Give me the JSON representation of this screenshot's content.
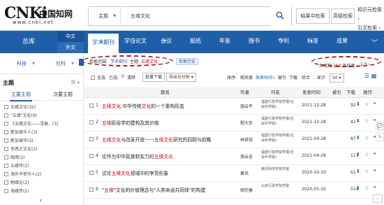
{
  "header": {
    "logo_text": "CNKi",
    "logo_cn": "中国知网",
    "logo_url": "www.cnki.net",
    "search_field": "主题",
    "search_value": "五缘文化",
    "in_results_label": "结果中检索",
    "advanced_label": "高级检索",
    "top_links": [
      "知识元检索 ›",
      "引文检索 ›"
    ]
  },
  "nav": {
    "zongku": "总库",
    "zhongwen": "中文",
    "waiwen": "外文",
    "tabs": [
      {
        "label": "学术期刊",
        "sub": "▾",
        "active": true
      },
      {
        "label": "学位论文",
        "sub": "▾",
        "active": false
      },
      {
        "label": "会议",
        "sub": "▾",
        "active": false
      },
      {
        "label": "报纸",
        "sub": "",
        "active": false
      },
      {
        "label": "年鉴",
        "sub": "",
        "active": false
      },
      {
        "label": "图书",
        "sub": "▾",
        "active": false
      },
      {
        "label": "专利",
        "sub": "▾",
        "active": false
      },
      {
        "label": "标准",
        "sub": "▾",
        "active": false
      },
      {
        "label": "成果",
        "sub": "",
        "active": false
      }
    ]
  },
  "sidebar": {
    "sources": [
      "科技",
      "社科"
    ],
    "facet_title": "主题",
    "facet_tabs": [
      "主要主题",
      "次要主题"
    ],
    "facet_items": [
      "五缘文化(32)",
      "\"五缘\"文化(9)",
      "《五缘文化——寻根...(3)",
      "新加坡华人(3)",
      "新加坡华(3)",
      "东西方文化(2)",
      "闽南(2)",
      "五缘传(2)",
      "海外华侨华人(2)",
      "物缘论(2)",
      "海缘传(2)"
    ],
    "more_label": "∨"
  },
  "main": {
    "scope_label": "检索范围:",
    "scope_value": "学术期刊",
    "topic_label": "主题:",
    "topic_value": "五缘文化",
    "history_label": "检索历史",
    "total_prefix": "共找到",
    "total_count": "103",
    "total_suffix": "条结果",
    "pager": "1/3 ›",
    "select_all": "全选",
    "selected_label": "已选:",
    "selected_count": "0",
    "clear_label": "清除",
    "batch_download": "批量下载",
    "export_analyze": "导出与分析 ▾",
    "sort_label": "排序:",
    "sort_items": [
      "相关度",
      "发表时间↓",
      "被引",
      "下载",
      "综合"
    ],
    "display_label": "显示",
    "display_count": "50 ▾"
  },
  "table": {
    "headers": [
      "题名",
      "作者",
      "刊名",
      "发表时间",
      "被引",
      "下载",
      "操作"
    ],
    "rows": [
      {
        "idx": "1",
        "title_pre": "",
        "title_hl": "五缘文化",
        "title_mid": ":中华传统",
        "title_hl2": "文化",
        "title_post": "的一个重构形态",
        "author": "施云平",
        "source": "福建行政学院学报(社会科学版)",
        "date": "2021-12-28",
        "cite": "",
        "dl": "92"
      },
      {
        "idx": "2",
        "title_pre": "",
        "title_hl": "五缘",
        "title_mid": "民俗学的建构及其价值",
        "title_hl2": "",
        "title_post": "",
        "author": "程大存",
        "source": "福建行政学院学报(社会科学版)",
        "date": "2021-12-28",
        "cite": "",
        "dl": "41"
      },
      {
        "idx": "3",
        "title_pre": "",
        "title_hl": "五缘文化",
        "title_mid": "与改革开放——",
        "title_hl2": "五缘文化",
        "title_post": "研究的回顾与前瞻",
        "author": "林其锬",
        "source": "福建行政学院学报(社会科学版)",
        "date": "2021-04-28",
        "cite": "",
        "dl": "87"
      },
      {
        "idx": "4",
        "title_pre": "论作为中华民族软实力的",
        "title_hl": "五缘文化",
        "title_mid": "",
        "title_hl2": "",
        "title_post": "",
        "author": "施云吉",
        "source": "福建行政学院学报(社会科学版)",
        "date": "2021-04-28",
        "cite": "",
        "dl": "113"
      },
      {
        "idx": "5",
        "title_pre": "试论",
        "title_hl": "五缘文化",
        "title_mid": "视域中的李贽形象",
        "title_hl2": "",
        "title_post": "",
        "author": "黄伟",
        "source": "黄冈师范学院学报",
        "date": "2020-10-10",
        "cite": "",
        "dl": "61"
      },
      {
        "idx": "6",
        "title_pre": "\"",
        "title_hl": "五缘",
        "title_mid": "\"文化的价值理念与\"人类命运共同体\"的构建",
        "title_hl2": "",
        "title_post": "",
        "author": "胡完善",
        "source": "北京行政学院学报",
        "date": "2020-05-10",
        "cite": "",
        "dl": "514"
      }
    ],
    "ops_icons": "⬇ ☆ ❝"
  },
  "float_tools": [
    "💬",
    "✎"
  ],
  "back_top": "︿"
}
